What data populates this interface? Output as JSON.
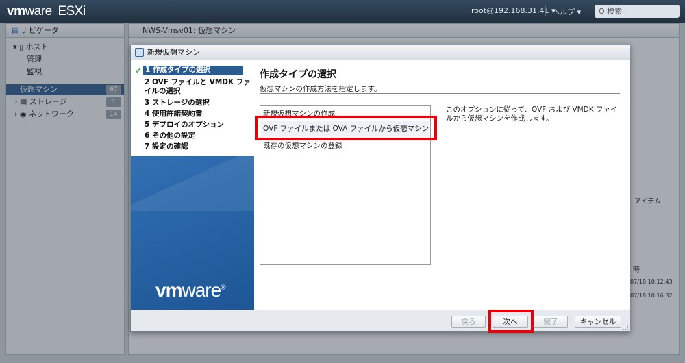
{
  "topbar": {
    "brand_vm": "vm",
    "brand_ware": "ware",
    "brand_product": "ESXi",
    "user": "root@192.168.31.41 ▾",
    "help": "ヘルプ ▾",
    "search_placeholder": "Q 検索"
  },
  "navigator": {
    "title": "ナビゲータ",
    "host_label": "ホスト",
    "host_children": [
      "管理",
      "監視"
    ],
    "items": [
      {
        "label": "仮想マシン",
        "count": "67"
      },
      {
        "label": "ストレージ",
        "count": "1"
      },
      {
        "label": "ネットワーク",
        "count": "14"
      }
    ]
  },
  "content": {
    "title": "NWS-Vmsv01: 仮想マシン",
    "right_labels": [
      "アイテム",
      "時"
    ],
    "timestamps": [
      "07/18 10:12:43",
      "07/18 10:16:32"
    ]
  },
  "dialog": {
    "title": "新規仮想マシン",
    "steps": [
      {
        "label": "1 作成タイプの選択",
        "active": true
      },
      {
        "label": "2 OVF ファイルと VMDK ファイルの選択"
      },
      {
        "label": "3 ストレージの選択"
      },
      {
        "label": "4 使用許諾契約書"
      },
      {
        "label": "5 デプロイのオプション"
      },
      {
        "label": "6 その他の設定"
      },
      {
        "label": "7 設定の確認"
      }
    ],
    "logo_vm": "vm",
    "logo_ware": "ware",
    "logo_reg": "®",
    "heading": "作成タイプの選択",
    "subheading": "仮想マシンの作成方法を指定します。",
    "options": [
      "新規仮想マシンの作成",
      "OVF ファイルまたは OVA ファイルから仮想マシンをデ...",
      "既存の仮想マシンの登録"
    ],
    "description": "このオプションに従って、OVF および VMDK ファイルから仮想マシンを作成します。",
    "buttons": {
      "back": "戻る",
      "next": "次へ",
      "finish": "完了",
      "cancel": "キャンセル"
    }
  },
  "colors": {
    "highlight": "#e8000b",
    "topbar": "#2c3e50",
    "wizard_blue": "#2a67aa"
  }
}
